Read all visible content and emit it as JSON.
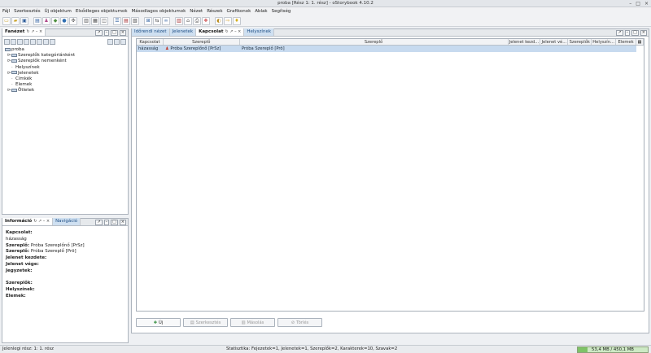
{
  "window": {
    "title": "proba [Rész 1: 1. rész] - oStorybook 4.10.2",
    "controls": [
      "–",
      "□",
      "×"
    ]
  },
  "menu": [
    "Fájl",
    "Szerkesztés",
    "Új objektum",
    "Elsődleges objektumok",
    "Másodlagos objektumok",
    "Nézet",
    "Részek",
    "Grafikonok",
    "Ablak",
    "Segítség"
  ],
  "toolbar_icons": [
    "new-file-icon",
    "open-folder-icon",
    "save-icon",
    "book-icon",
    "people-icon",
    "location-icon",
    "globe-icon",
    "network-icon",
    "layout-icon",
    "split-icon",
    "view-icon",
    "list-icon",
    "table-icon",
    "chapter-icon",
    "grid-icon",
    "arrow-icon",
    "chain-icon",
    "chart-icon",
    "nav-icon",
    "print-icon",
    "export-icon",
    "settings-icon",
    "back-icon",
    "forward-icon",
    "help-icon"
  ],
  "tree_panel": {
    "tab_label": "Fanézet",
    "root": "proba",
    "items": [
      {
        "label": "Szereplők kategóriánként",
        "type": "folder"
      },
      {
        "label": "Szereplők nemenként",
        "type": "folder"
      },
      {
        "label": "Helyszínek",
        "type": "leaf"
      },
      {
        "label": "Jelenetek",
        "type": "folder"
      },
      {
        "label": "Címkék",
        "type": "leaf"
      },
      {
        "label": "Elemek",
        "type": "leaf"
      },
      {
        "label": "Ötletek",
        "type": "folder"
      }
    ]
  },
  "info_panel": {
    "tabs": [
      "Információ",
      "Navigáció"
    ],
    "lines": [
      {
        "label": "Kapcsolat:",
        "value": ""
      },
      {
        "label": "",
        "value": "házasság"
      },
      {
        "label": "Szereplő:",
        "value": "Próba Szereplőnő [PrSz]"
      },
      {
        "label": "Szereplő:",
        "value": "Próba Szereplő [Prö]"
      },
      {
        "label": "Jelenet kezdete:",
        "value": ""
      },
      {
        "label": "Jelenet vége:",
        "value": ""
      },
      {
        "label": "Jegyzetek:",
        "value": ""
      },
      {
        "label": "",
        "value": ""
      },
      {
        "label": "Szereplők:",
        "value": ""
      },
      {
        "label": "Helyszínek:",
        "value": ""
      },
      {
        "label": "Elemek:",
        "value": ""
      }
    ]
  },
  "main_panel": {
    "tabs": [
      "Időrendi nézet",
      "Jelenetek",
      "Kapcsolat",
      "Helyszínek"
    ],
    "active_tab": "Kapcsolat",
    "columns": [
      "Kapcsolat",
      "Szereplő",
      "Szereplő",
      "Jelenet kezd...",
      "Jelenet vé...",
      "Szereplők",
      "Helyszín...",
      "Elemek"
    ],
    "rows": [
      [
        "házasság",
        "Próba Szereplőnő [PrSz]",
        "Próba Szereplő [Prö]",
        "",
        "",
        "",
        "",
        ""
      ]
    ],
    "buttons": {
      "new": "Új",
      "edit": "Szerkesztés",
      "copy": "Másolás",
      "delete": "Törlés"
    }
  },
  "status": {
    "left": "Jelenlegi rész: 1: 1. rész",
    "stats": "Statisztika: Fejezetek=1, Jelenetek=1, Szereplők=2, Karakterek=10, Szavak=2",
    "memory": "53,4 MB / 450,1 MB"
  },
  "colors": {
    "accent": "#c7daef",
    "memory_bar": "#7fc267"
  }
}
